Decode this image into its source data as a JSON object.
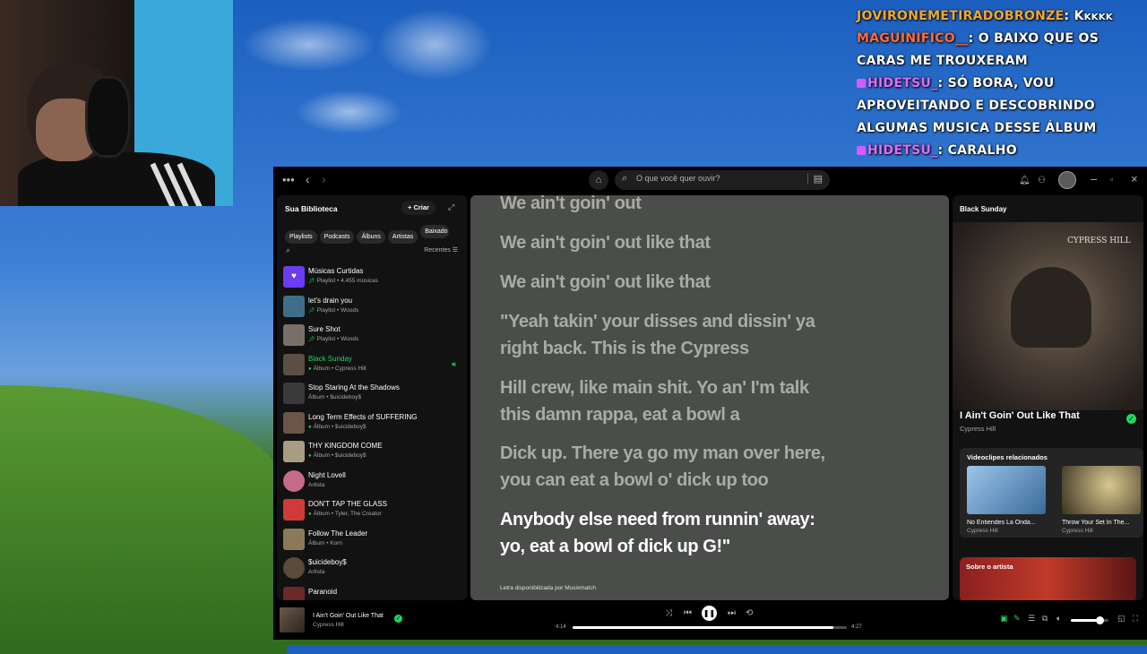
{
  "chat": {
    "messages": [
      {
        "user": "JOVIRONEMETIRADOBRONZE",
        "text": "Kkkkk"
      },
      {
        "user": "MAGUINIFICO__",
        "text": "O BAIXO QUE OS CARAS ME TROUXERAM"
      },
      {
        "user": "HIDETSU_",
        "text": "SÓ BORA, VOU APROVEITANDO E DESCOBRINDO ALGUMAS MUSICA DESSE ÁLBUM"
      },
      {
        "user": "HIDETSU_",
        "text": "CARALHO"
      }
    ]
  },
  "topbar": {
    "search_placeholder": "O que você quer ouvir?"
  },
  "sidebar": {
    "title": "Sua Biblioteca",
    "create_label": "Criar",
    "filters": [
      "Playlists",
      "Podcasts",
      "Álbuns",
      "Artistas",
      "Baixado"
    ],
    "sort_label": "Recentes",
    "items": [
      {
        "name": "Músicas Curtidas",
        "sub": "Playlist • 4.455 músicas",
        "pinned": true,
        "color": "#6b3cf0"
      },
      {
        "name": "let's drain you",
        "sub": "Playlist • Woods",
        "pinned": true,
        "color": "#3e6e8a"
      },
      {
        "name": "Sure Shot",
        "sub": "Playlist • Woods",
        "pinned": true,
        "color": "#7a6f66"
      },
      {
        "name": "Black Sunday",
        "sub": "Álbum • Cypress Hill",
        "downloaded": true,
        "active": true,
        "color": "#5b4e44"
      },
      {
        "name": "Stop Staring At the Shadows",
        "sub": "Álbum • $uicideboy$",
        "color": "#3a3a3a"
      },
      {
        "name": "Long Term Effects of SUFFERING",
        "sub": "Álbum • $uicideboy$",
        "downloaded": true,
        "color": "#6a5546"
      },
      {
        "name": "THY KINGDOM COME",
        "sub": "Álbum • $uicideboy$",
        "downloaded": true,
        "color": "#a89c82"
      },
      {
        "name": "Night Lovell",
        "sub": "Artista",
        "round": true,
        "color": "#c46a8a"
      },
      {
        "name": "DON'T TAP THE GLASS",
        "sub": "Álbum • Tyler, The Creator",
        "downloaded": true,
        "color": "#d23a3a"
      },
      {
        "name": "Follow The Leader",
        "sub": "Álbum • Korn",
        "color": "#8a7a5a"
      },
      {
        "name": "$uicideboy$",
        "sub": "Artista",
        "round": true,
        "color": "#5a4a3a"
      },
      {
        "name": "Paranoid",
        "sub": "",
        "color": "#6a2a2a"
      }
    ]
  },
  "lyrics": {
    "lines": [
      {
        "text": "We ain't goin' out",
        "current": false
      },
      {
        "text": "We ain't goin' out like that",
        "current": false
      },
      {
        "text": "We ain't goin' out like that",
        "current": false
      },
      {
        "text": "\"Yeah takin' your disses and dissin' ya right back. This is the Cypress",
        "current": false
      },
      {
        "text": "Hill crew, like main shit. Yo an' I'm talk this damn rappa, eat a bowl a",
        "current": false
      },
      {
        "text": "Dick up. There ya go my man over here, you can eat a bowl o' dick up too",
        "current": false
      },
      {
        "text": "Anybody else need from runnin' away: yo, eat a bowl of dick up G!\"",
        "current": true
      }
    ],
    "credit": "Letra disponibilizada por Musixmatch"
  },
  "now_playing_view": {
    "context_title": "Black Sunday",
    "cover_logo": "CYPRESS HILL",
    "song": "I Ain't Goin' Out Like That",
    "artist": "Cypress Hill",
    "related_title": "Videoclipes relacionados",
    "videos": [
      {
        "title": "No Entiendes La Onda...",
        "artist": "Cypress Hill",
        "color": "#6aa0d0"
      },
      {
        "title": "Throw Your Set In The...",
        "artist": "Cypress Hill",
        "color": "#8a7a50"
      }
    ],
    "about_label": "Sobre o artista"
  },
  "player": {
    "song": "I Ain't Goin' Out Like That",
    "artist": "Cypress Hill",
    "elapsed": "4:14",
    "duration": "4:27",
    "progress": 0.95,
    "volume": 0.75
  }
}
